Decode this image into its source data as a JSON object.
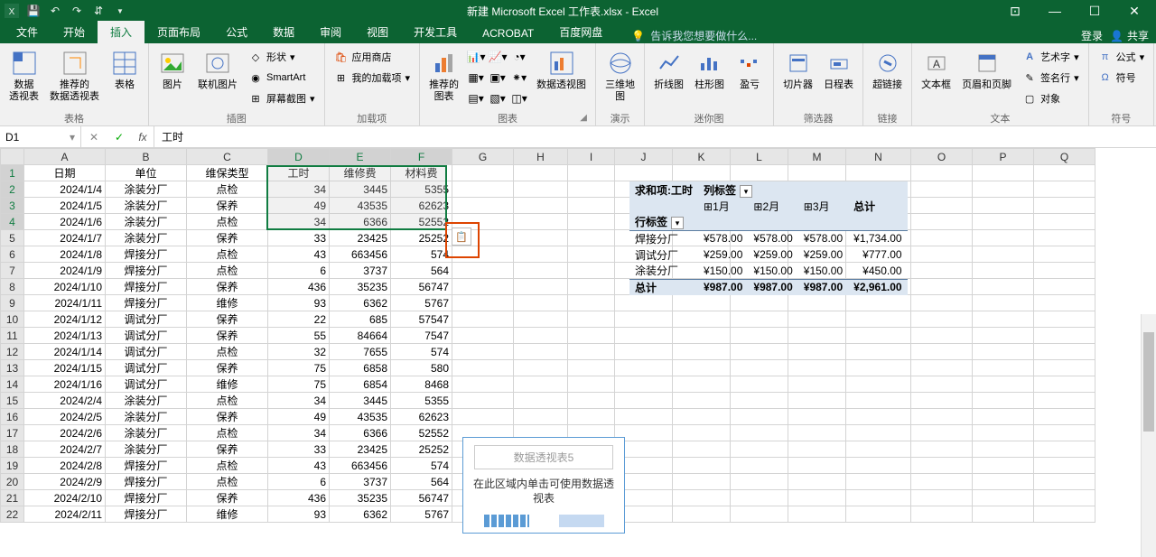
{
  "app": {
    "title": "新建 Microsoft Excel 工作表.xlsx - Excel"
  },
  "qat": {
    "save": "save",
    "undo": "undo",
    "redo": "redo",
    "touch": "touch"
  },
  "tabs": {
    "items": [
      "文件",
      "开始",
      "插入",
      "页面布局",
      "公式",
      "数据",
      "审阅",
      "视图",
      "开发工具",
      "ACROBAT",
      "百度网盘"
    ],
    "active_index": 2,
    "tell_me": "告诉我您想要做什么...",
    "login": "登录",
    "share": "共享"
  },
  "ribbon": {
    "groups": {
      "tables": {
        "label": "表格",
        "pivot": "数据\n透视表",
        "recommend": "推荐的\n数据透视表",
        "table": "表格"
      },
      "illustrations": {
        "label": "插图",
        "picture": "图片",
        "online_pic": "联机图片",
        "shapes": "形状",
        "smartart": "SmartArt",
        "screenshot": "屏幕截图"
      },
      "addins": {
        "label": "加载项",
        "store": "应用商店",
        "my_addins": "我的加载项"
      },
      "charts": {
        "label": "图表",
        "recommend": "推荐的\n图表",
        "pivotchart": "数据透视图"
      },
      "tours": {
        "label": "演示",
        "map3d": "三维地\n图"
      },
      "sparklines": {
        "label": "迷你图",
        "line": "折线图",
        "column": "柱形图",
        "winloss": "盈亏"
      },
      "filters": {
        "label": "筛选器",
        "slicer": "切片器",
        "timeline": "日程表"
      },
      "links": {
        "label": "链接",
        "hyperlink": "超链接"
      },
      "text": {
        "label": "文本",
        "textbox": "文本框",
        "headerfooter": "页眉和页脚",
        "wordart": "艺术字",
        "signature": "签名行",
        "object": "对象"
      },
      "symbols": {
        "label": "符号",
        "equation": "公式",
        "symbol": "符号"
      }
    }
  },
  "formulabar": {
    "namebox": "D1",
    "formula": "工时"
  },
  "sheet": {
    "columns": [
      "A",
      "B",
      "C",
      "D",
      "E",
      "F",
      "G",
      "H",
      "I",
      "J",
      "K",
      "L",
      "M",
      "N",
      "O",
      "P",
      "Q"
    ],
    "headers": {
      "A": "日期",
      "B": "单位",
      "C": "维保类型",
      "D": "工时",
      "E": "维修费",
      "F": "材料费"
    },
    "rows": [
      {
        "n": 2,
        "A": "2024/1/4",
        "B": "涂装分厂",
        "C": "点检",
        "D": 34,
        "E": 3445,
        "F": 5355
      },
      {
        "n": 3,
        "A": "2024/1/5",
        "B": "涂装分厂",
        "C": "保养",
        "D": 49,
        "E": 43535,
        "F": 62623
      },
      {
        "n": 4,
        "A": "2024/1/6",
        "B": "涂装分厂",
        "C": "点检",
        "D": 34,
        "E": 6366,
        "F": 52552
      },
      {
        "n": 5,
        "A": "2024/1/7",
        "B": "涂装分厂",
        "C": "保养",
        "D": 33,
        "E": 23425,
        "F": 25252
      },
      {
        "n": 6,
        "A": "2024/1/8",
        "B": "焊接分厂",
        "C": "点检",
        "D": 43,
        "E": 663456,
        "F": 574
      },
      {
        "n": 7,
        "A": "2024/1/9",
        "B": "焊接分厂",
        "C": "点检",
        "D": 6,
        "E": 3737,
        "F": 564
      },
      {
        "n": 8,
        "A": "2024/1/10",
        "B": "焊接分厂",
        "C": "保养",
        "D": 436,
        "E": 35235,
        "F": 56747
      },
      {
        "n": 9,
        "A": "2024/1/11",
        "B": "焊接分厂",
        "C": "维修",
        "D": 93,
        "E": 6362,
        "F": 5767
      },
      {
        "n": 10,
        "A": "2024/1/12",
        "B": "调试分厂",
        "C": "保养",
        "D": 22,
        "E": 685,
        "F": 57547
      },
      {
        "n": 11,
        "A": "2024/1/13",
        "B": "调试分厂",
        "C": "保养",
        "D": 55,
        "E": 84664,
        "F": 7547
      },
      {
        "n": 12,
        "A": "2024/1/14",
        "B": "调试分厂",
        "C": "点检",
        "D": 32,
        "E": 7655,
        "F": 574
      },
      {
        "n": 13,
        "A": "2024/1/15",
        "B": "调试分厂",
        "C": "保养",
        "D": 75,
        "E": 6858,
        "F": 580
      },
      {
        "n": 14,
        "A": "2024/1/16",
        "B": "调试分厂",
        "C": "维修",
        "D": 75,
        "E": 6854,
        "F": 8468
      },
      {
        "n": 15,
        "A": "2024/2/4",
        "B": "涂装分厂",
        "C": "点检",
        "D": 34,
        "E": 3445,
        "F": 5355
      },
      {
        "n": 16,
        "A": "2024/2/5",
        "B": "涂装分厂",
        "C": "保养",
        "D": 49,
        "E": 43535,
        "F": 62623
      },
      {
        "n": 17,
        "A": "2024/2/6",
        "B": "涂装分厂",
        "C": "点检",
        "D": 34,
        "E": 6366,
        "F": 52552
      },
      {
        "n": 18,
        "A": "2024/2/7",
        "B": "涂装分厂",
        "C": "保养",
        "D": 33,
        "E": 23425,
        "F": 25252
      },
      {
        "n": 19,
        "A": "2024/2/8",
        "B": "焊接分厂",
        "C": "点检",
        "D": 43,
        "E": 663456,
        "F": 574
      },
      {
        "n": 20,
        "A": "2024/2/9",
        "B": "焊接分厂",
        "C": "点检",
        "D": 6,
        "E": 3737,
        "F": 564
      },
      {
        "n": 21,
        "A": "2024/2/10",
        "B": "焊接分厂",
        "C": "保养",
        "D": 436,
        "E": 35235,
        "F": 56747
      },
      {
        "n": 22,
        "A": "2024/2/11",
        "B": "焊接分厂",
        "C": "维修",
        "D": 93,
        "E": 6362,
        "F": 5767
      }
    ]
  },
  "pivot": {
    "value_label": "求和项:工时",
    "col_label": "列标签",
    "row_label": "行标签",
    "months": [
      "1月",
      "2月",
      "3月"
    ],
    "total": "总计",
    "rows": [
      {
        "name": "焊接分厂",
        "vals": [
          "¥578.00",
          "¥578.00",
          "¥578.00",
          "¥1,734.00"
        ]
      },
      {
        "name": "调试分厂",
        "vals": [
          "¥259.00",
          "¥259.00",
          "¥259.00",
          "¥777.00"
        ]
      },
      {
        "name": "涂装分厂",
        "vals": [
          "¥150.00",
          "¥150.00",
          "¥150.00",
          "¥450.00"
        ]
      }
    ],
    "totals": [
      "¥987.00",
      "¥987.00",
      "¥987.00",
      "¥2,961.00"
    ]
  },
  "pivot2": {
    "title": "数据透视表5",
    "msg1": "在此区域内单击可使用数据透",
    "msg2": "视表"
  }
}
